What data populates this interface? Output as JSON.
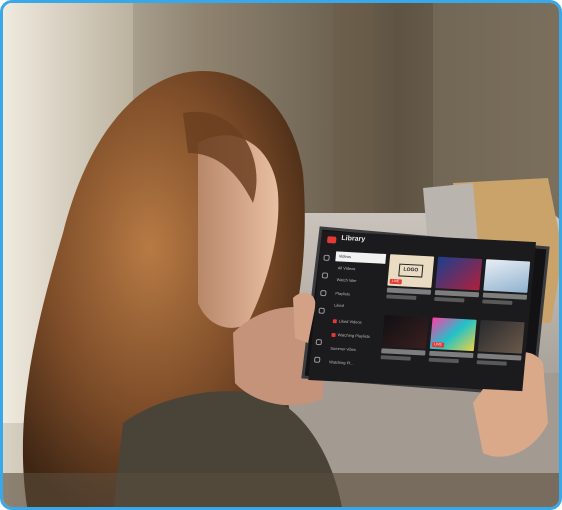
{
  "scene": {
    "description_free": true
  },
  "tablet_app": {
    "title": "Library",
    "nav_icons": [
      "home-icon",
      "explore-icon",
      "subscriptions-icon",
      "library-icon",
      "history-icon",
      "settings-icon"
    ],
    "sidebar_items": [
      {
        "label": "Videos",
        "active": true
      },
      {
        "label": "All Videos",
        "active": false
      },
      {
        "label": "Watch later",
        "active": false
      },
      {
        "label": "Playlists",
        "active": false
      },
      {
        "label": "Liked",
        "active": false
      },
      {
        "label": "Liked Videos",
        "active": false
      },
      {
        "label": "Watching Playlists",
        "active": false
      },
      {
        "label": "Summer vibes",
        "active": false
      },
      {
        "label": "Watching Pl...",
        "active": false
      }
    ],
    "cards": [
      {
        "thumb_text": "LOGO",
        "badge": "LIVE"
      },
      {
        "thumb_text": "",
        "badge": ""
      },
      {
        "thumb_text": "",
        "badge": ""
      },
      {
        "thumb_text": "",
        "badge": ""
      },
      {
        "thumb_text": "",
        "badge": "LIVE"
      },
      {
        "thumb_text": "",
        "badge": ""
      }
    ],
    "colors": {
      "accent": "#e53935",
      "background": "#1b1b1d",
      "frame_border": "#38a8e8"
    }
  }
}
